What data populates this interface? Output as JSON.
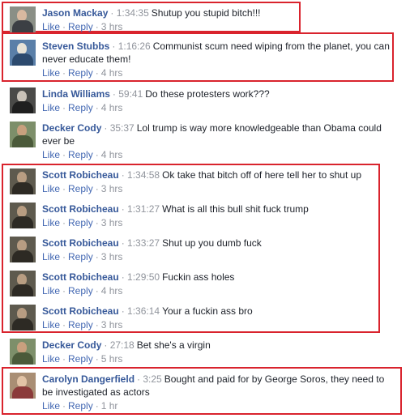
{
  "actions": {
    "like": "Like",
    "reply": "Reply",
    "separator": "·"
  },
  "comments": [
    {
      "author": "Jason Mackay",
      "time": "1:34:35",
      "text": "Shutup you stupid bitch!!!",
      "age": "3 hrs"
    },
    {
      "author": "Steven Stubbs",
      "time": "1:16:26",
      "text": "Communist scum need wiping from the planet, you can never educate them!",
      "age": "4 hrs"
    },
    {
      "author": "Linda Williams",
      "time": "59:41",
      "text": "Do these protesters work???",
      "age": "4 hrs"
    },
    {
      "author": "Decker Cody",
      "time": "35:37",
      "text": "Lol trump is way more knowledgeable than Obama could ever be",
      "age": "4 hrs"
    },
    {
      "author": "Scott Robicheau",
      "time": "1:34:58",
      "text": "Ok take that bitch off of here tell her to shut up",
      "age": "3 hrs"
    },
    {
      "author": "Scott Robicheau",
      "time": "1:31:27",
      "text": "What is all this bull shit fuck trump",
      "age": "3 hrs"
    },
    {
      "author": "Scott Robicheau",
      "time": "1:33:27",
      "text": "Shut up you dumb fuck",
      "age": "3 hrs"
    },
    {
      "author": "Scott Robicheau",
      "time": "1:29:50",
      "text": "Fuckin ass holes",
      "age": "4 hrs"
    },
    {
      "author": "Scott Robicheau",
      "time": "1:36:14",
      "text": "Your a fuckin ass bro",
      "age": "3 hrs"
    },
    {
      "author": "Decker Cody",
      "time": "27:18",
      "text": "Bet she's a virgin",
      "age": "5 hrs"
    },
    {
      "author": "Carolyn Dangerfield",
      "time": "3:25",
      "text": "Bought and paid for by George Soros, they need to be investigated as actors",
      "age": "1 hr"
    }
  ],
  "colors": {
    "author_link": "#365899",
    "action_link": "#4267b2",
    "meta_gray": "#90949c",
    "highlight_border": "#d9232d"
  }
}
